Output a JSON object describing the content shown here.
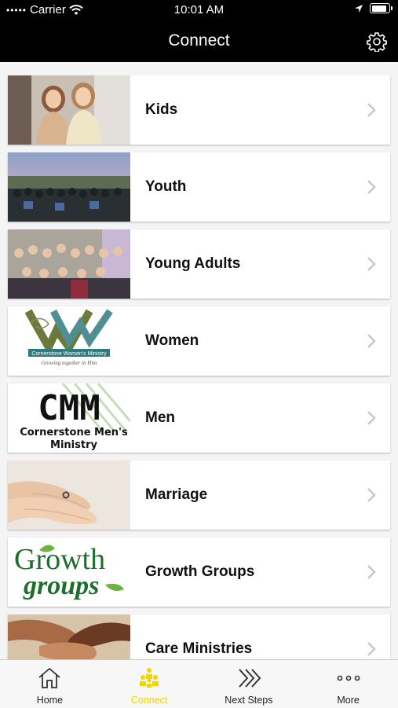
{
  "status_bar": {
    "carrier": "Carrier",
    "time": "10:01 AM",
    "battery_level": 0.95
  },
  "nav": {
    "title": "Connect",
    "settings_icon": "gear-icon"
  },
  "ministries": [
    {
      "label": "Kids",
      "image": "kids-photo"
    },
    {
      "label": "Youth",
      "image": "youth-group-photo"
    },
    {
      "label": "Young Adults",
      "image": "young-adults-photo"
    },
    {
      "label": "Women",
      "image": "womens-ministry-logo",
      "logo_text": "Cornerstone Women's Ministry",
      "logo_tagline": "Growing together in Him"
    },
    {
      "label": "Men",
      "image": "mens-ministry-logo",
      "logo_main": "CMM",
      "logo_line1": "Cornerstone Men's",
      "logo_line2": "Ministry"
    },
    {
      "label": "Marriage",
      "image": "hands-with-rings-photo"
    },
    {
      "label": "Growth Groups",
      "image": "growth-groups-logo",
      "logo_line1": "Growth",
      "logo_line2": "groups"
    },
    {
      "label": "Care Ministries",
      "image": "joined-hands-photo"
    }
  ],
  "tab_bar": {
    "tabs": [
      {
        "label": "Home",
        "icon": "house-icon",
        "active": false
      },
      {
        "label": "Connect",
        "icon": "people-icon",
        "active": true
      },
      {
        "label": "Next Steps",
        "icon": "double-chevron-icon",
        "active": false
      },
      {
        "label": "More",
        "icon": "ellipsis-icon",
        "active": false
      }
    ]
  },
  "colors": {
    "nav_background": "#000000",
    "active_tab": "#f2d400",
    "chevron": "#c7c7cc"
  }
}
